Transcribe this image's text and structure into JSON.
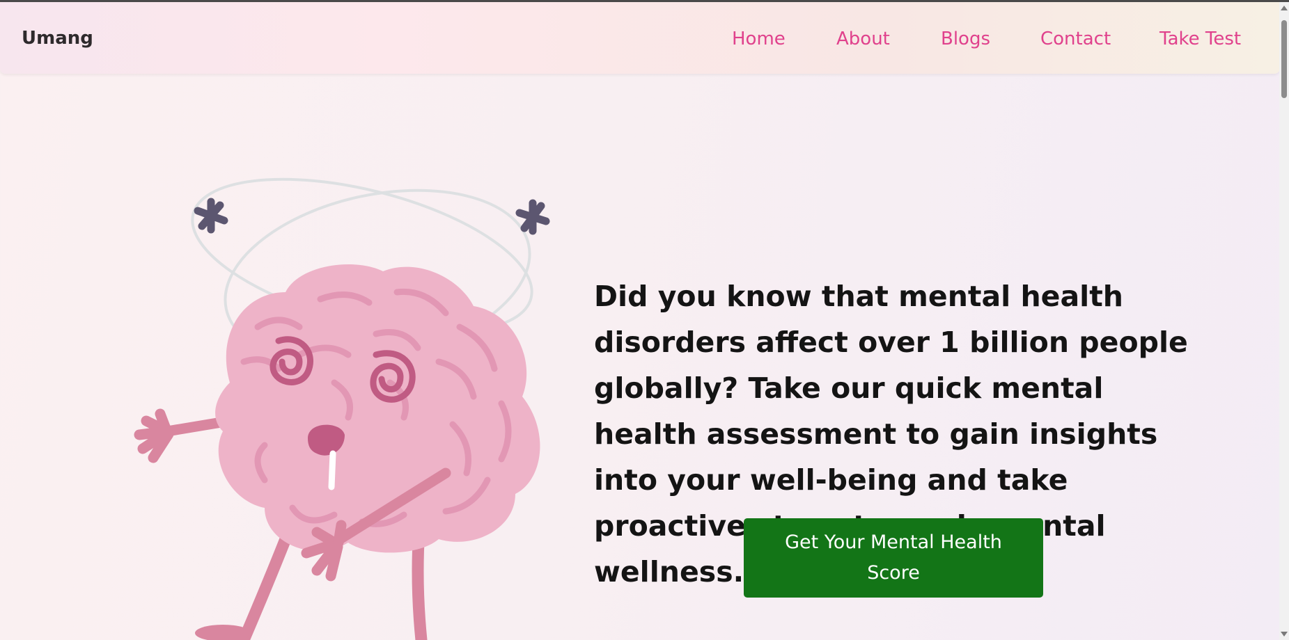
{
  "navbar": {
    "brand": "Umang",
    "links": [
      {
        "label": "Home"
      },
      {
        "label": "About"
      },
      {
        "label": "Blogs"
      },
      {
        "label": "Contact"
      },
      {
        "label": "Take Test"
      }
    ]
  },
  "hero": {
    "message": "Did you know that mental health disorders affect over 1 billion people globally? Take our quick mental health assessment to gain insights into your well-being and take proactive steps towards mental wellness.",
    "cta_label": "Get Your Mental Health Score",
    "illustration_icon": "dizzy-brain-icon"
  },
  "colors": {
    "nav_link": "#e0418c",
    "cta_background": "#137517",
    "brain_pink": "#eeb3c8"
  }
}
